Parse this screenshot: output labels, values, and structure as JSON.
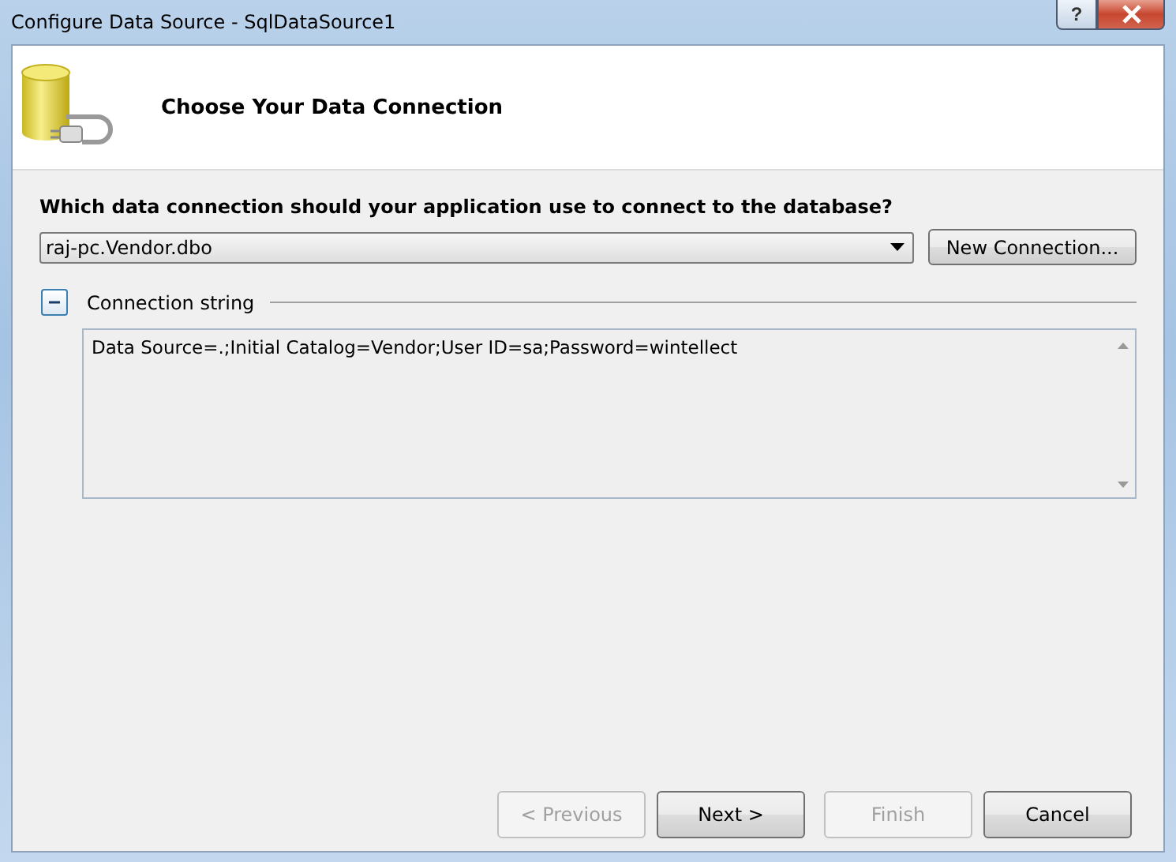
{
  "window": {
    "title": "Configure Data Source - SqlDataSource1",
    "help_button": "?"
  },
  "header": {
    "title": "Choose Your Data Connection"
  },
  "question": "Which data connection should your application use to connect to the database?",
  "connection": {
    "value": "raj-pc.Vendor.dbo"
  },
  "new_connection_button": "New Connection...",
  "connection_string": {
    "label": "Connection string",
    "expanded": true,
    "value": "Data Source=.;Initial Catalog=Vendor;User ID=sa;Password=wintellect"
  },
  "buttons": [
    {
      "label": "< Previous",
      "disabled": true
    },
    {
      "label": "Next >",
      "disabled": false
    },
    {
      "label": "Finish",
      "disabled": true
    },
    {
      "label": "Cancel",
      "disabled": false
    }
  ]
}
